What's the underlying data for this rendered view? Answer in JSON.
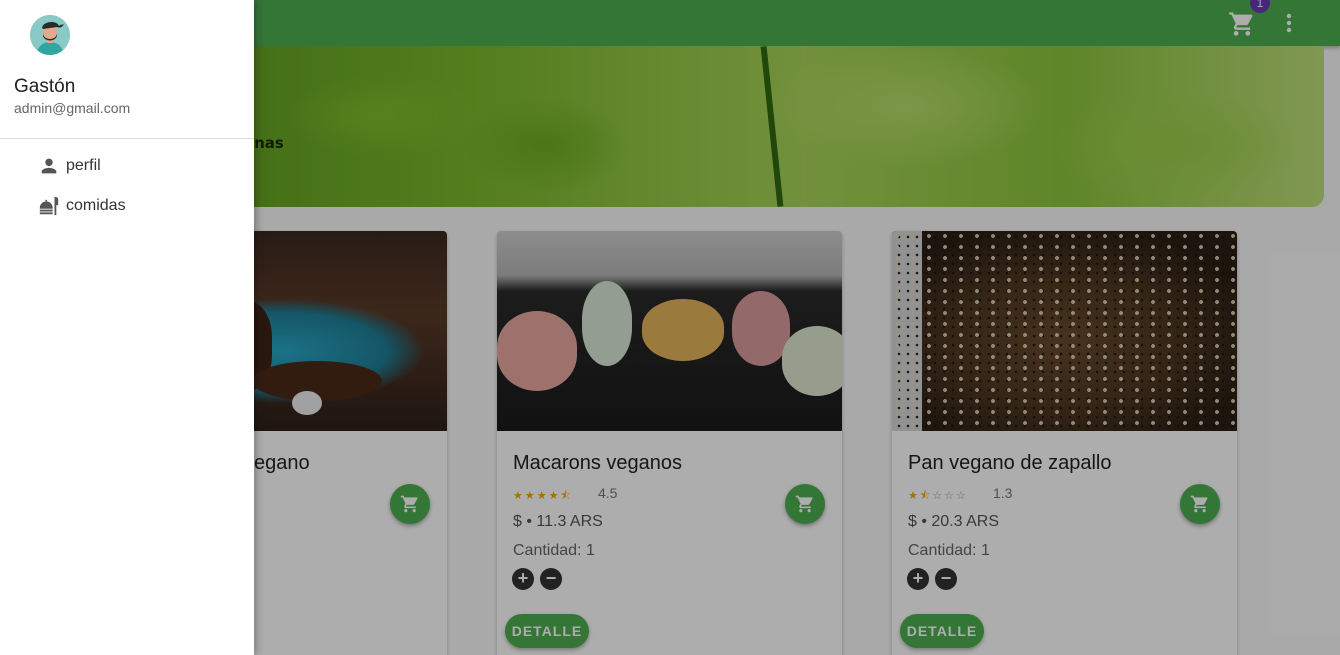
{
  "appbar": {
    "cart_badge": "1",
    "icons": {
      "cart": "cart-icon",
      "more": "more-vert-icon"
    },
    "color": "#4caf50"
  },
  "hero": {
    "tagline": "as y vegetarianas"
  },
  "products": [
    {
      "title": "egano",
      "photo": "vegan dessert on a blue plate"
    },
    {
      "title": "Macarons veganos",
      "rating": 4.5,
      "rating_label": "4.5",
      "stars": "★★★★⯪",
      "price": "$ • 11.3 ARS",
      "quantity": "Cantidad: 1",
      "detail_label": "DETALLE"
    },
    {
      "title": "Pan vegano de zapallo",
      "rating": 1.3,
      "rating_label": "1.3",
      "stars": "★⯪☆☆☆",
      "price": "$ • 20.3 ARS",
      "quantity": "Cantidad: 1",
      "detail_label": "DETALLE"
    }
  ],
  "drawer": {
    "user_name": "Gastón",
    "user_email": "admin@gmail.com",
    "items": [
      {
        "label": "perfil",
        "icon": "person-icon"
      },
      {
        "label": "comidas",
        "icon": "food-icon"
      }
    ]
  },
  "colors": {
    "primary": "#4caf50",
    "badge": "#673ab7",
    "star": "#f4a700"
  }
}
